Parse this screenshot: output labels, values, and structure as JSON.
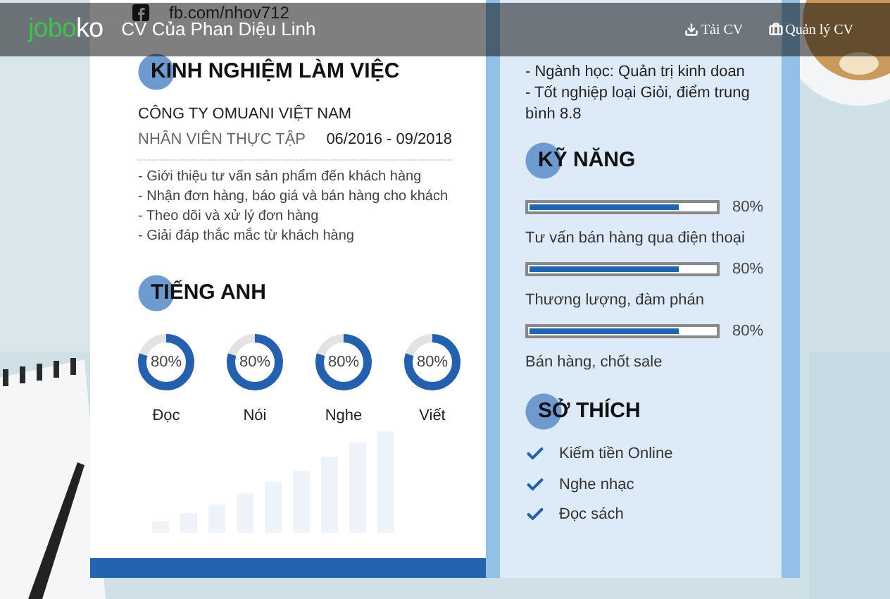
{
  "header": {
    "logo": {
      "part_1": "jobo",
      "part_2": "ko"
    },
    "title": "CV Của Phan Diệu Linh",
    "actions": [
      {
        "kind": "download",
        "label": "Tải CV"
      },
      {
        "kind": "manage",
        "label": "Quản lý CV"
      }
    ]
  },
  "contact": {
    "facebook": "fb.com/nhov712"
  },
  "experience": {
    "heading": "KINH NGHIỆM LÀM VIỆC",
    "company": "CÔNG TY OMUANI VIỆT NAM",
    "position": "NHÂN VIÊN THỰC TẬP",
    "period": "06/2016 - 09/2018",
    "duties": [
      "- Giới thiệu tư vấn sản phẩm đến khách hàng",
      "- Nhận đơn hàng, báo giá và bán hàng cho khách",
      "- Theo dõi và xử lý đơn hàng",
      "- Giải đáp thắc mắc từ khách hàng"
    ]
  },
  "english": {
    "heading": "TIẾNG ANH",
    "skills": [
      {
        "label": "Đọc",
        "reading": "80%",
        "level": 0.8
      },
      {
        "label": "Nói",
        "reading": "80%",
        "level": 0.8
      },
      {
        "label": "Nghe",
        "reading": "80%",
        "level": 0.8
      },
      {
        "label": "Viết",
        "reading": "80%",
        "level": 0.8
      }
    ]
  },
  "education": [
    "- Ngành học: Quản trị kinh doan",
    "- Tốt nghiệp loại Giỏi, điểm trung bình 8.8"
  ],
  "skills": {
    "heading": "KỸ NĂNG",
    "items": [
      {
        "label": "Tư vấn bán hàng qua điện thoại",
        "reading": "80%",
        "level": 0.8
      },
      {
        "label": "Thương lượng, đàm phán",
        "reading": "80%",
        "level": 0.8
      },
      {
        "label": "Bán hàng, chốt sale",
        "reading": "80%",
        "level": 0.8
      }
    ]
  },
  "hobbies": {
    "heading": "SỞ THÍCH",
    "items": [
      "Kiếm tiền Online",
      "Nghe nhạc",
      "Đọc sách"
    ]
  }
}
